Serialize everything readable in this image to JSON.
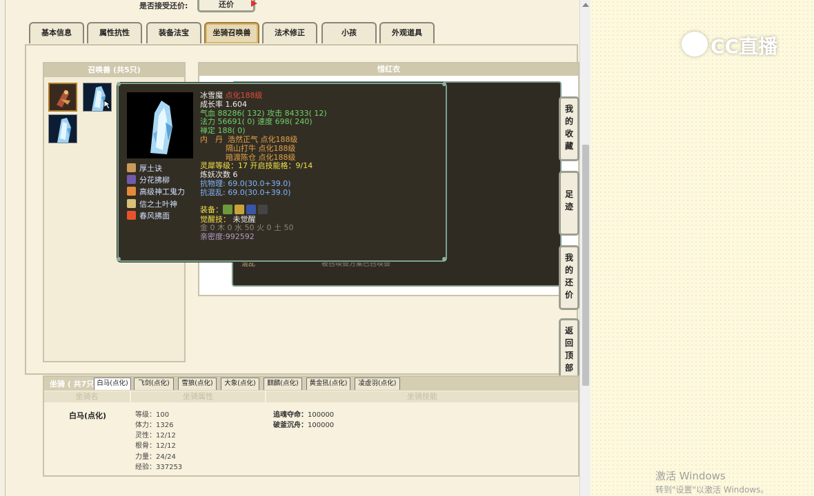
{
  "header": {
    "accept_label": "是否接受还价:",
    "bargain_button": "还价"
  },
  "tabs": [
    {
      "label": "基本信息"
    },
    {
      "label": "属性抗性"
    },
    {
      "label": "装备法宝"
    },
    {
      "label": "坐骑召唤兽",
      "active": true
    },
    {
      "label": "法术修正"
    },
    {
      "label": "小孩"
    },
    {
      "label": "外观道具"
    }
  ],
  "pets_panel": {
    "title": "召唤兽 (共5只)"
  },
  "name_panel": {
    "title": "惜红衣"
  },
  "background_row": {
    "skill": "混乱",
    "desc": "被召唤兽方案已召唤兽"
  },
  "tooltip": {
    "name": "冰雪魔",
    "level": "点化188级",
    "growth": "成长率 1.604",
    "hp_label": "气血",
    "hp_value": "88286( 132)",
    "atk_label": "攻击",
    "atk_value": "84333( 12)",
    "mana_label": "法力",
    "mana_value": "56691( 0)",
    "speed_label": "速度",
    "speed_value": "698( 240)",
    "zen_label": "禅定",
    "zen_value": "188( 0)",
    "dan_label": "内　丹",
    "dan1": "浩然正气 点化188级",
    "dan2": "隔山打牛 点化188级",
    "dan3": "暗渡陈仓 点化188级",
    "spirit_label": "灵犀等级：",
    "spirit_value": "17 开启技能格：9/14",
    "refine": "炼妖次数 6",
    "phys_res_label": "抗物理:",
    "phys_res_value": "69.0(30.0+39.0)",
    "chaos_res_label": "抗混乱:",
    "chaos_res_value": "69.0(30.0+39.0)",
    "equip_label": "装备：",
    "awaken_label": "觉醒技：",
    "awaken_value": "未觉醒",
    "elements": "金 0 木 0 水 50 火 0 土 50",
    "intimacy": "亲密度:992592",
    "skills": [
      {
        "name": "厚土诀",
        "icon": "earth-scroll-icon",
        "color": "#c99a5a"
      },
      {
        "name": "分花拂柳",
        "icon": "flower-willow-icon",
        "color": "#6f5ba8"
      },
      {
        "name": "高级神工鬼力",
        "icon": "strength-icon",
        "color": "#e58a3a"
      },
      {
        "name": "信之土叶神",
        "icon": "earth-spirit-icon",
        "color": "#d8c07a"
      },
      {
        "name": "春风拂面",
        "icon": "flame-icon",
        "color": "#e5542a"
      }
    ]
  },
  "side_buttons": [
    {
      "label": "我的收藏",
      "chars": [
        "我",
        "的",
        "收",
        "藏"
      ]
    },
    {
      "label": "足迹",
      "chars": [
        "足",
        "迹"
      ]
    },
    {
      "label": "我的还价",
      "chars": [
        "我",
        "的",
        "还",
        "价"
      ]
    },
    {
      "label": "返回顶部",
      "chars": [
        "返",
        "回",
        "顶",
        "部"
      ]
    }
  ],
  "mounts": {
    "count_label": "坐骑 ( 共7只",
    "tabs": [
      {
        "label": "白马(点化)",
        "active": true
      },
      {
        "label": "飞剑(点化)"
      },
      {
        "label": "雪狼(点化)"
      },
      {
        "label": "大象(点化)"
      },
      {
        "label": "麒麟(点化)"
      },
      {
        "label": "黄金犼(点化)"
      },
      {
        "label": "凌虚羽(点化)"
      }
    ],
    "col_name": "坐骑名",
    "col_attr": "坐骑属性",
    "col_skill": "坐骑技能",
    "selected_name": "白马(点化)",
    "attributes": [
      "等级：100",
      "体力：1326",
      "灵性：12/12",
      "根骨：12/12",
      "力量：24/24",
      "经验：337253"
    ],
    "skills": [
      {
        "name": "追魂夺命：",
        "value": "100000"
      },
      {
        "name": "破釜沉舟：",
        "value": "100000"
      }
    ]
  },
  "overlay": {
    "cc_logo_text": "CC直播",
    "activate_line1": "激活 Windows",
    "activate_line2": "转到\"设置\"以激活 Windows。"
  },
  "colors": {
    "accent_tab": "#9e7b3a",
    "tooltip_bg": "#332e24",
    "tooltip_border": "#7da291",
    "level_red": "#e34a3c",
    "stat_green": "#6fd36a",
    "stat_yellow": "#f3e04a",
    "stat_blue": "#7fb7ff"
  }
}
